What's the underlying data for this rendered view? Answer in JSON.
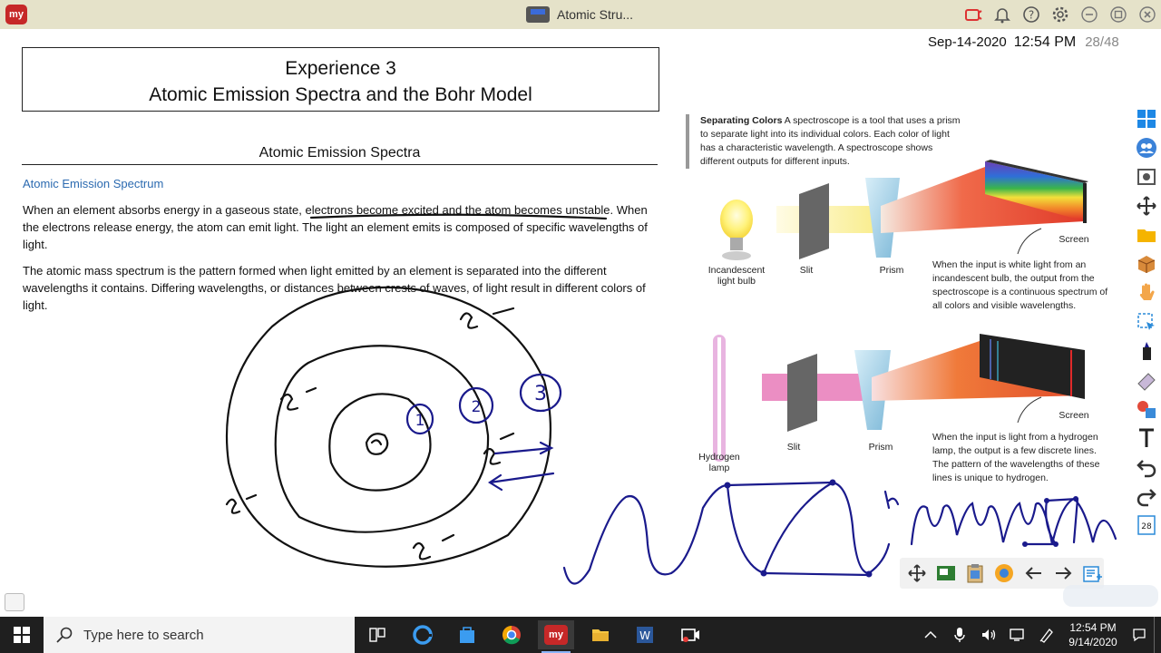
{
  "app": {
    "logo_text": "my",
    "window_title": "Atomic Stru..."
  },
  "header": {
    "date": "Sep-14-2020",
    "time": "12:54 PM",
    "page": "28/48"
  },
  "document": {
    "heading_line1": "Experience 3",
    "heading_line2": "Atomic Emission Spectra and the Bohr Model",
    "section_title": "Atomic Emission Spectra",
    "subsection": "Atomic Emission Spectrum",
    "para1_a": "When an element absorbs energy in a gaseous state, ",
    "para1_b": "electrons become excited and the atom becomes unstable",
    "para1_c": ".  When the electrons release energy, the atom can emit light.  The light an element emits is composed of specific wavelengths of light.",
    "para2": "The atomic mass spectrum is the pattern formed when light emitted by an element is separated into the different wavelengths it contains.  Differing wavelengths, or distances between crests of waves, of light result in different colors of light."
  },
  "figure": {
    "caption_title": "Separating Colors",
    "caption_text": " A spectroscope is a tool that uses a prism to separate light into its individual colors. Each color of light has a characteristic wavelength. A spectroscope shows different outputs for different inputs.",
    "label_bulb": "Incandescent light bulb",
    "label_slit1": "Slit",
    "label_prism1": "Prism",
    "label_screen1": "Screen",
    "desc1": "When the input is white light from an incandescent bulb, the output from the spectroscope is a continuous spectrum of all colors and visible wavelengths.",
    "label_lamp": "Hydrogen lamp",
    "label_slit2": "Slit",
    "label_prism2": "Prism",
    "label_screen2": "Screen",
    "desc2": "When the input is light from a hydrogen lamp, the output is a few discrete lines. The pattern of the wavelengths of these lines is unique to hydrogen."
  },
  "annotations": {
    "shell_labels": [
      "1",
      "2",
      "3"
    ],
    "electron_label": "e",
    "wave_label": "h"
  },
  "toolbar": {
    "page_badge": "28"
  },
  "taskbar": {
    "search_placeholder": "Type here to search",
    "clock_time": "12:54 PM",
    "clock_date": "9/14/2020"
  },
  "colors": {
    "ink": "#1a1a8c",
    "link": "#2b6ab0",
    "titlebar": "#e5e2c9",
    "taskbar": "#1f1f1f"
  }
}
